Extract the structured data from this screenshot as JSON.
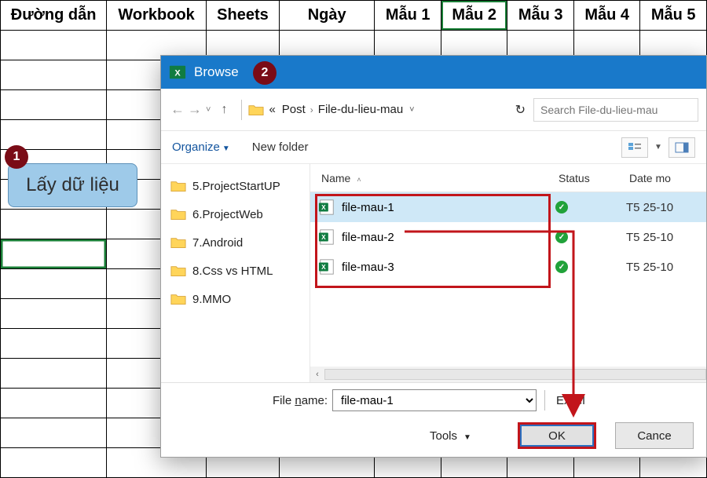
{
  "sheet": {
    "headers": [
      "Đường dẫn",
      "Workbook",
      "Sheets",
      "Ngày",
      "Mẫu 1",
      "Mẫu 2",
      "Mẫu 3",
      "Mẫu 4",
      "Mẫu 5"
    ]
  },
  "callout": {
    "step1": "1",
    "step2": "2",
    "button_label": "Lấy dữ liệu"
  },
  "dialog": {
    "title": "Browse",
    "nav": {
      "prefix": "«",
      "crumb1": "Post",
      "crumb2": "File-du-lieu-mau",
      "search_placeholder": "Search File-du-lieu-mau"
    },
    "toolbar": {
      "organize": "Organize",
      "new_folder": "New folder"
    },
    "tree": {
      "items": [
        {
          "label": "5.ProjectStartUP"
        },
        {
          "label": "6.ProjectWeb"
        },
        {
          "label": "7.Android"
        },
        {
          "label": "8.Css vs HTML"
        },
        {
          "label": "9.MMO"
        }
      ]
    },
    "file_header": {
      "name": "Name",
      "status": "Status",
      "date": "Date mo"
    },
    "files": [
      {
        "name": "file-mau-1",
        "date": "T5 25-10",
        "selected": true
      },
      {
        "name": "file-mau-2",
        "date": "T5 25-10",
        "selected": false
      },
      {
        "name": "file-mau-3",
        "date": "T5 25-10",
        "selected": false
      }
    ],
    "footer": {
      "file_name_label_pre": "File ",
      "file_name_label_ul": "n",
      "file_name_label_post": "ame:",
      "file_name_value": "file-mau-1",
      "file_type": "Excel",
      "tools": "Tools",
      "ok": "OK",
      "cancel": "Cance"
    }
  }
}
